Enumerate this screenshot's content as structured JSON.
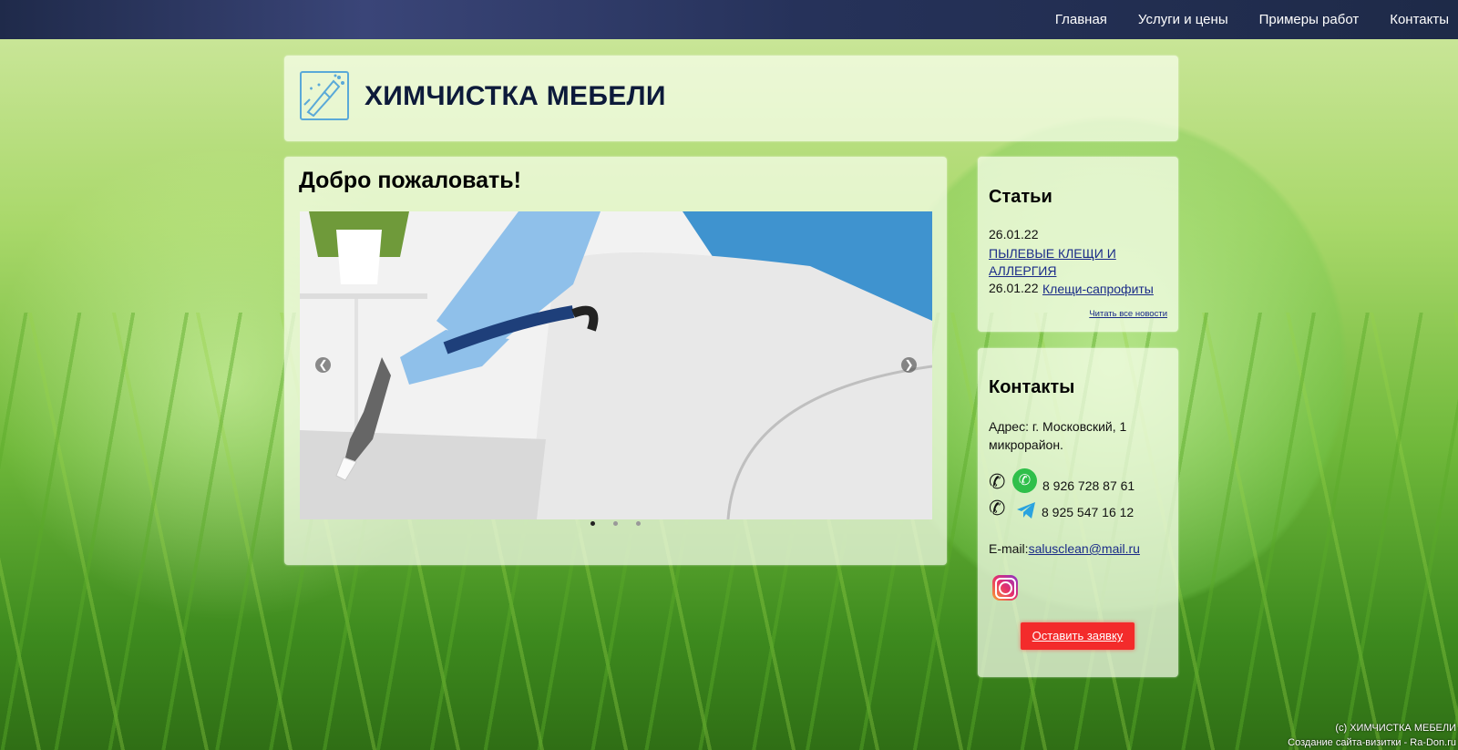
{
  "nav": {
    "items": [
      {
        "label": "Главная"
      },
      {
        "label": "Услуги и цены"
      },
      {
        "label": "Примеры работ"
      },
      {
        "label": "Контакты"
      }
    ]
  },
  "header": {
    "title": "ХИМЧИСТКА МЕБЕЛИ",
    "logo_icon": "cleaning-spray-icon"
  },
  "main": {
    "heading": "Добро пожаловать!",
    "slider": {
      "slide_count": 3,
      "active_slide": 1,
      "prev_icon": "chevron-left-icon",
      "next_icon": "chevron-right-icon"
    }
  },
  "articles": {
    "title": "Статьи",
    "items": [
      {
        "date": "26.01.22",
        "title": "ПЫЛЕВЫЕ КЛЕЩИ И АЛЛЕРГИЯ"
      },
      {
        "date": "26.01.22",
        "title": "Клещи-сапрофиты"
      }
    ],
    "read_all": "Читать все новости"
  },
  "contacts": {
    "title": "Контакты",
    "address": "Адрес: г. Московский, 1 микрорайон.",
    "phones": [
      {
        "messenger_icon": "whatsapp-icon",
        "number": "8 926 728 87 61"
      },
      {
        "messenger_icon": "telegram-icon",
        "number": "8 925 547 16 12"
      }
    ],
    "email_label": "E-mail:",
    "email": "salusclean@mail.ru",
    "social_icon": "instagram-icon",
    "request_button": "Оставить заявку"
  },
  "footer": {
    "copyright": "(с) ХИМЧИСТКА МЕБЕЛИ",
    "credit": "Создание сайта-визитки - Ra-Don.ru"
  },
  "colors": {
    "nav_bg": "#26325a",
    "link": "#1a2b88",
    "button": "#f32b2b",
    "title": "#0d1a3a"
  }
}
